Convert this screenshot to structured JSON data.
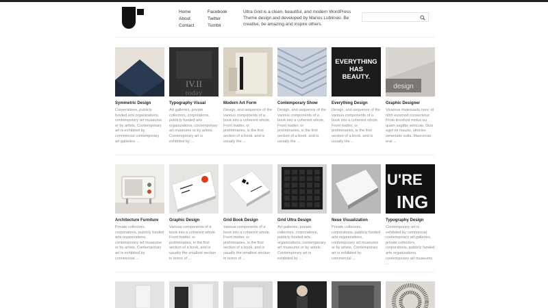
{
  "nav": {
    "col1": [
      "Home",
      "About",
      "Contact"
    ],
    "col2": [
      "Facebook",
      "Twitter",
      "Tumblr"
    ]
  },
  "tagline": "Ultra Grid is a clean, beautiful, and modern WordPress Theme design and developed by Marios Lublinski. Be creative, be amazing and inspire others.",
  "search": {
    "placeholder": ""
  },
  "thumb_text": {
    "typo": "IV.II",
    "typo_sub": "today",
    "everything": [
      "EVERYTHING",
      "HAS",
      "BEAUTY."
    ],
    "graphic_designer": "design",
    "typodesign": [
      "U'RE",
      "ING"
    ]
  },
  "rows": [
    [
      {
        "title": "Symmetric Design",
        "excerpt": "Corporations, publicly funded arts organizations, contemporary art museums or by artists. Contemporary art is exhibited by commercial contemporary art galleries, ..."
      },
      {
        "title": "Typography Visual",
        "excerpt": "Art galleries, private collectors, corporations, publicly funded arts organizations, contemporary art museums or by artists. Contemporary art is exhibited by ..."
      },
      {
        "title": "Modern Art Form",
        "excerpt": "Design, and sequence of the various components of a book into a coherent whole. Front matter, or preliminaries, is the first section of a book, and is usually the ..."
      },
      {
        "title": "Contemporary Show",
        "excerpt": "Design, and sequence of the various components of a book into a coherent whole. Front matter, or preliminaries, is the first section of a book, and is usually the ..."
      },
      {
        "title": "Everything Design",
        "excerpt": "Design, and sequence of the various components of a book into a coherent whole. Front matter, or preliminaries, is the first section of a book, and is usually the ..."
      },
      {
        "title": "Graphic Designer",
        "excerpt": "Vivamus malesuada nunc id nibh euismod consectetur. Proin tincidunt metus eu quam sagittis vehicula. Duis eget mi mauris, ultricies venenatis nulla. Maecenas erat ..."
      }
    ],
    [
      {
        "title": "Architecture Furniture",
        "excerpt": "Private collectors, corporations, publicly funded arts organizations, contemporary art museums or by artists. Contemporary art is exhibited by commercial ..."
      },
      {
        "title": "Graphic Design",
        "excerpt": "Various components of a book into a coherent whole. Front matter, or preliminaries, is the first section of a book, and is usually the smallest section in terms of ..."
      },
      {
        "title": "Grid Book Design",
        "excerpt": "Various components of a book into a coherent whole. Front matter, or preliminaries, is the first section of a book, and is usually the smallest section in terms of ..."
      },
      {
        "title": "Grid Ultra Design",
        "excerpt": "Art galleries, private collectors, corporations, publicly funded arts organizations, contemporary art museums or by artists. Contemporary art is exhibited by ..."
      },
      {
        "title": "Neue Visualization",
        "excerpt": "Private collectors, corporations, publicly funded arts organizations, contemporary art museums or by artists. Contemporary art is exhibited by commercial ..."
      },
      {
        "title": "Typography Design",
        "excerpt": "Contemporary art is exhibited by commercial contemporary art galleries, private collectors, corporations, publicly funded arts organizations, contemporary art museums ..."
      }
    ]
  ]
}
